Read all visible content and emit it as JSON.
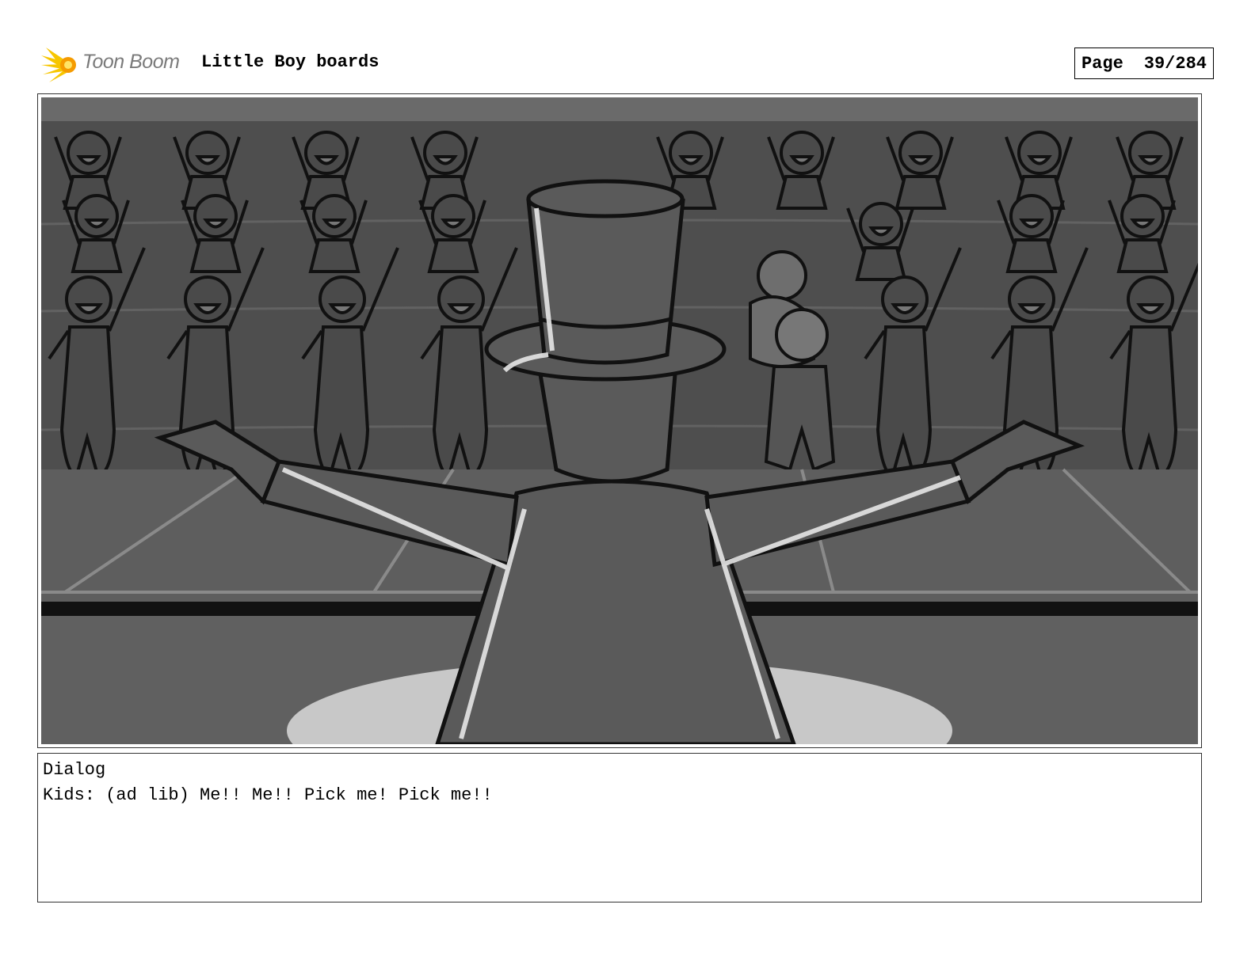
{
  "header": {
    "logo_text": "Toon Boom",
    "title": "Little Boy boards",
    "page_label": "Page",
    "page_number": "39/284"
  },
  "panel": {
    "icon": "storyboard-sketch-image"
  },
  "dialog": {
    "label": "Dialog",
    "text": "Kids: (ad lib) Me!! Me!! Pick me! Pick me!!"
  }
}
